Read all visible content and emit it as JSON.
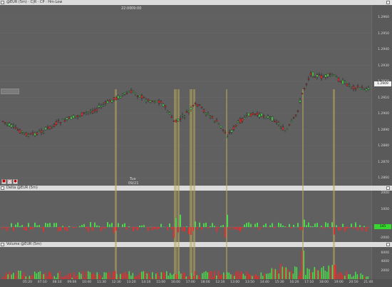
{
  "main_header": {
    "text": "@EUR (5m) · C|R · CP · Hm·Low"
  },
  "delta_header": {
    "text": "Delta @EUR (5m)"
  },
  "volume_header": {
    "text": "Volume @EUR (5m)"
  },
  "sessions": [
    "22:00",
    "09:00"
  ],
  "date_label": {
    "day": "Tue",
    "date": "09/21"
  },
  "price_axis": [
    "1.2960",
    "1.2950",
    "1.2940",
    "1.2930",
    "1.2920",
    "1.2910",
    "1.2900",
    "1.2890",
    "1.2880",
    "1.2870",
    "1.2860"
  ],
  "current_price": "1.2909",
  "delta_axis": [
    "2000",
    "1000",
    "-1000",
    "-2000"
  ],
  "delta_value": "145",
  "volume_axis": [
    "6000",
    "4000",
    "2000"
  ],
  "time_axis": [
    "05:20",
    "07:10",
    "08:10",
    "09:00",
    "10:40",
    "11:30",
    "12:30",
    "13:20",
    "14:10",
    "15:00",
    "16:00",
    "17:00",
    "18:00",
    "12:10",
    "13:00",
    "13:50",
    "14:40",
    "15:30",
    "16:20",
    "17:10",
    "18:00",
    "19:00",
    "20:50",
    "21:40"
  ],
  "colors": {
    "up": "#4ad94a",
    "down": "#e03030",
    "highlight": "#b8a85a"
  }
}
